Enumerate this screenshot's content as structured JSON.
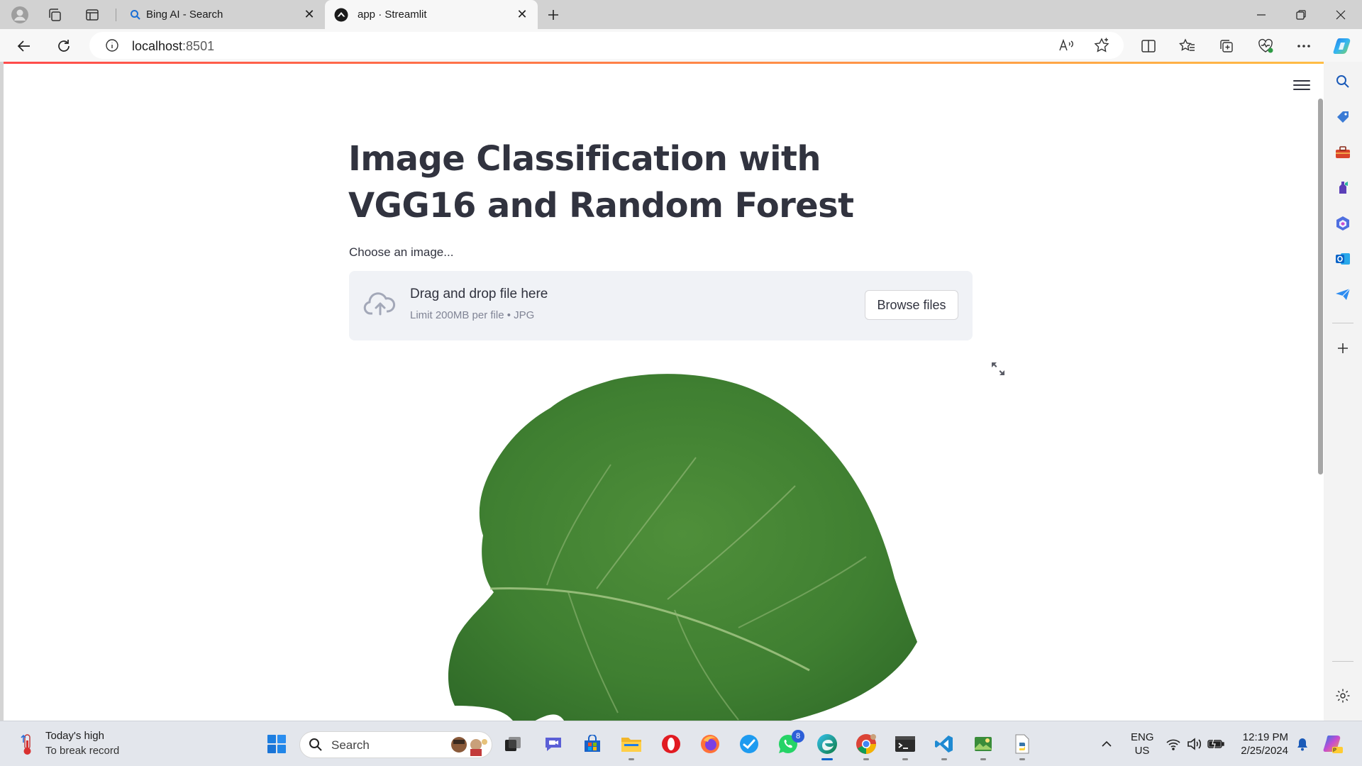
{
  "browser": {
    "tabs": [
      {
        "label": "Bing AI - Search",
        "active": false,
        "favicon": "search-icon"
      },
      {
        "label": "app · Streamlit",
        "active": true,
        "favicon": "streamlit-icon"
      }
    ],
    "url_host": "localhost",
    "url_port": ":8501",
    "toolbar_icons": [
      "back-icon",
      "refresh-icon",
      "site-info-icon",
      "read-aloud-icon",
      "favorite-star-icon",
      "split-screen-icon",
      "favorites-icon",
      "collections-icon",
      "browser-essentials-icon",
      "more-icon",
      "copilot-icon"
    ],
    "sidebar_icons": [
      "search-icon",
      "shopping-icon",
      "tools-icon",
      "games-icon",
      "microsoft365-icon",
      "outlook-icon",
      "drop-icon",
      "add-icon",
      "settings-icon"
    ]
  },
  "app": {
    "title": "Image Classification with VGG16 and Random Forest",
    "uploader_label": "Choose an image...",
    "dropzone_title": "Drag and drop file here",
    "dropzone_limit": "Limit 200MB per file • JPG",
    "browse_button": "Browse files",
    "accent_colors": [
      "#ff4b4b",
      "#ffbd45"
    ]
  },
  "taskbar": {
    "weather_line1": "Today's high",
    "weather_line2": "To break record",
    "search_label": "Search",
    "lang_line1": "ENG",
    "lang_line2": "US",
    "time": "12:19 PM",
    "date": "2/25/2024",
    "whatsapp_badge": "8"
  }
}
